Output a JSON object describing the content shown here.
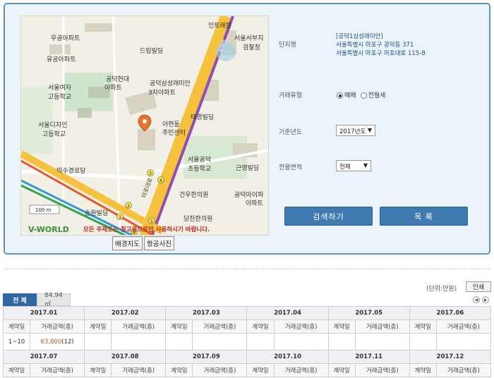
{
  "map": {
    "labels": {
      "intrabel": "인트래블",
      "seoul_west_prosecutors": "서울서부지",
      "prosecutors2": "검찰청",
      "ugong_apt": "우공아파트",
      "yugong_apt": "유공아파트",
      "dream_bldg": "드림빌딩",
      "hyundai_apt": "공덕현대",
      "hyundai_apt2": "아파트",
      "samsung_raemian": "공덕삼성래미안",
      "samsung_raemian2": "3차아파트",
      "seoul_girls_hs": "서울여자",
      "seoul_girls_hs2": "고등학교",
      "taeyoung_bldg": "태영빌딩",
      "seoul_design_hs": "서울디자인",
      "seoul_design_hs2": "고등학교",
      "ahyeon_center": "아현동",
      "ahyeon_center2": "주민센터",
      "iksu_road": "익수경로당",
      "seoul_gongdeok_es": "서울공덕",
      "seoul_gongdeok_es2": "초등학교",
      "geunyoung_bldg": "근영빌딩",
      "geonwoo_clinic": "건우한의원",
      "gongdeok_i_apt": "공덕아이파",
      "gongdeok_i_apt2": "아파트",
      "songwon_bldg": "송원빌딩",
      "dangsan_clinic": "당찬한의원",
      "road_label": "공덕역",
      "road_label2": "마포대로",
      "scale": "100 m",
      "vworld": "V-WORLD",
      "notice": "모든 주제도는 참고용으로만 사용하시기 바랍니다.",
      "route_5": "5",
      "route_3": "3",
      "route_4": "4",
      "route_2": "2",
      "route_1": "1",
      "route_6": "6"
    },
    "btn_base": "배경지도",
    "btn_aerial": "항공사진"
  },
  "info": {
    "complex_label": "단지명",
    "complex_name": "[공덕1삼성래미안]",
    "address1": "서울특별시 마포구 공덕동 371",
    "address2": "서울특별시 마포구 마포대로 115-8",
    "trade_type_label": "거래유형",
    "trade_sale": "매매",
    "trade_lease": "전월세",
    "year_label": "기준년도",
    "year_value": "2017년도",
    "area_label": "전용면적",
    "area_value": "전체",
    "search_btn": "검색하기",
    "list_btn": "목 록"
  },
  "results": {
    "unit": "(단위:만원)",
    "print": "인쇄",
    "tab_all": "전 체",
    "tab_area": "84.94㎡",
    "col_day": "계약일",
    "col_amount": "거래금액(층)",
    "months_h1": [
      "2017.01",
      "2017.02",
      "2017.03",
      "2017.04",
      "2017.05",
      "2017.06"
    ],
    "months_h2": [
      "2017.07",
      "2017.08",
      "2017.09",
      "2017.10",
      "2017.11",
      "2017.12"
    ],
    "jan_day": "1~10",
    "jan_price": "63,800",
    "jan_floor": "(12)"
  },
  "icons": {
    "map_pin": "map-pin-icon",
    "pager_prev": "pager-prev-icon",
    "pager_next": "pager-next-icon"
  },
  "colors": {
    "accent": "#3f7ab1",
    "panel_border": "#5b93bf",
    "price": "#c0581b"
  }
}
